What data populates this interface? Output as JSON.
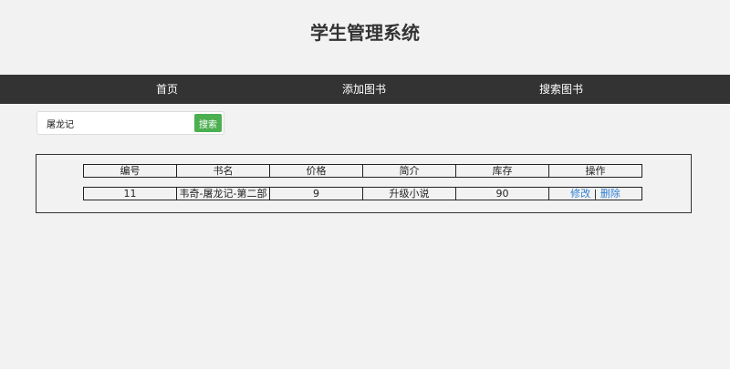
{
  "header": {
    "title": "学生管理系统"
  },
  "nav": {
    "items": [
      {
        "label": "首页"
      },
      {
        "label": "添加图书"
      },
      {
        "label": "搜索图书"
      }
    ]
  },
  "search": {
    "value": "屠龙记",
    "button_label": "搜索"
  },
  "table": {
    "columns": [
      "编号",
      "书名",
      "价格",
      "简介",
      "库存",
      "操作"
    ],
    "rows": [
      {
        "id": "11",
        "name": "韦奇-屠龙记-第二部",
        "price": "9",
        "intro": "升级小说",
        "stock": "90",
        "actions": {
          "edit": "修改",
          "separator": "|",
          "delete": "删除"
        }
      }
    ]
  },
  "colors": {
    "background": "#f2f2f2",
    "navbar": "#333333",
    "search_button": "#4caf50",
    "link": "#2f7fd4"
  }
}
